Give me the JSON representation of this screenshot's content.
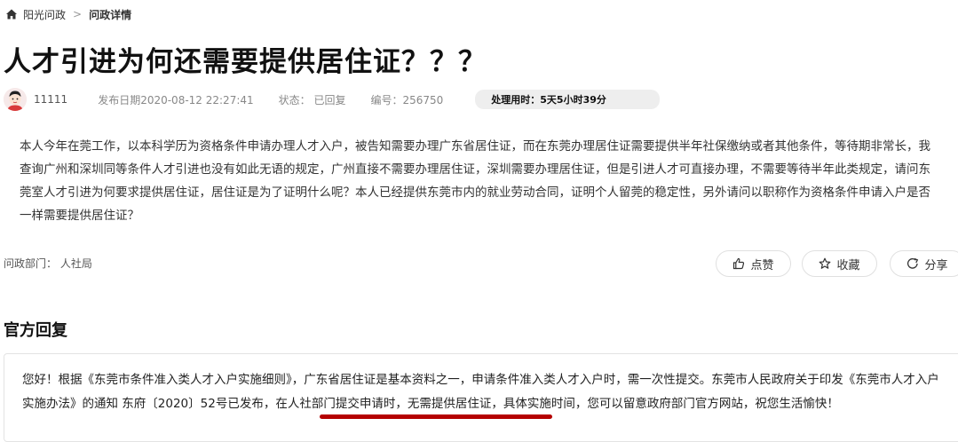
{
  "breadcrumb": {
    "home_icon": "home-icon",
    "root": "阳光问政",
    "separator": ">",
    "current": "问政详情"
  },
  "title": "人才引进为何还需要提供居住证？？？",
  "meta": {
    "author": "11111",
    "publish_date": "发布日期2020-08-12 22:27:41",
    "status": "状态：  已回复",
    "number": "编号：256750",
    "duration": "处理用时：5天5小时39分"
  },
  "body": "本人今年在莞工作，以本科学历为资格条件申请办理人才入户，被告知需要办理广东省居住证，而在东莞办理居住证需要提供半年社保缴纳或者其他条件，等待期非常长，我查询广州和深圳同等条件人才引进也没有如此无语的规定，广州直接不需要办理居住证，深圳需要办理居住证，但是引进人才可直接办理，不需要等待半年此类规定，请问东莞室人才引进为何要求提供居住证，居住证是为了证明什么呢？本人已经提供东莞市内的就业劳动合同，证明个人留莞的稳定性，另外请问以职称作为资格条件申请入户是否一样需要提供居住证？",
  "department": "问政部门：  人社局",
  "actions": {
    "like": "点赞",
    "favorite": "收藏",
    "share": "分享"
  },
  "reply": {
    "heading": "官方回复",
    "text": "您好！根据《东莞市条件准入类人才入户实施细则》，广东省居住证是基本资料之一，申请条件准入类人才入户时，需一次性提交。东莞市人民政府关于印发《东莞市人才入户实施办法》的通知 东府〔2020〕52号已发布，在人社部门提交申请时，无需提供居住证，具体实施时间，您可以留意政府部门官方网站，祝您生活愉快！"
  },
  "colors": {
    "underline": "#b50000",
    "badge_bg": "#eeeeee"
  }
}
